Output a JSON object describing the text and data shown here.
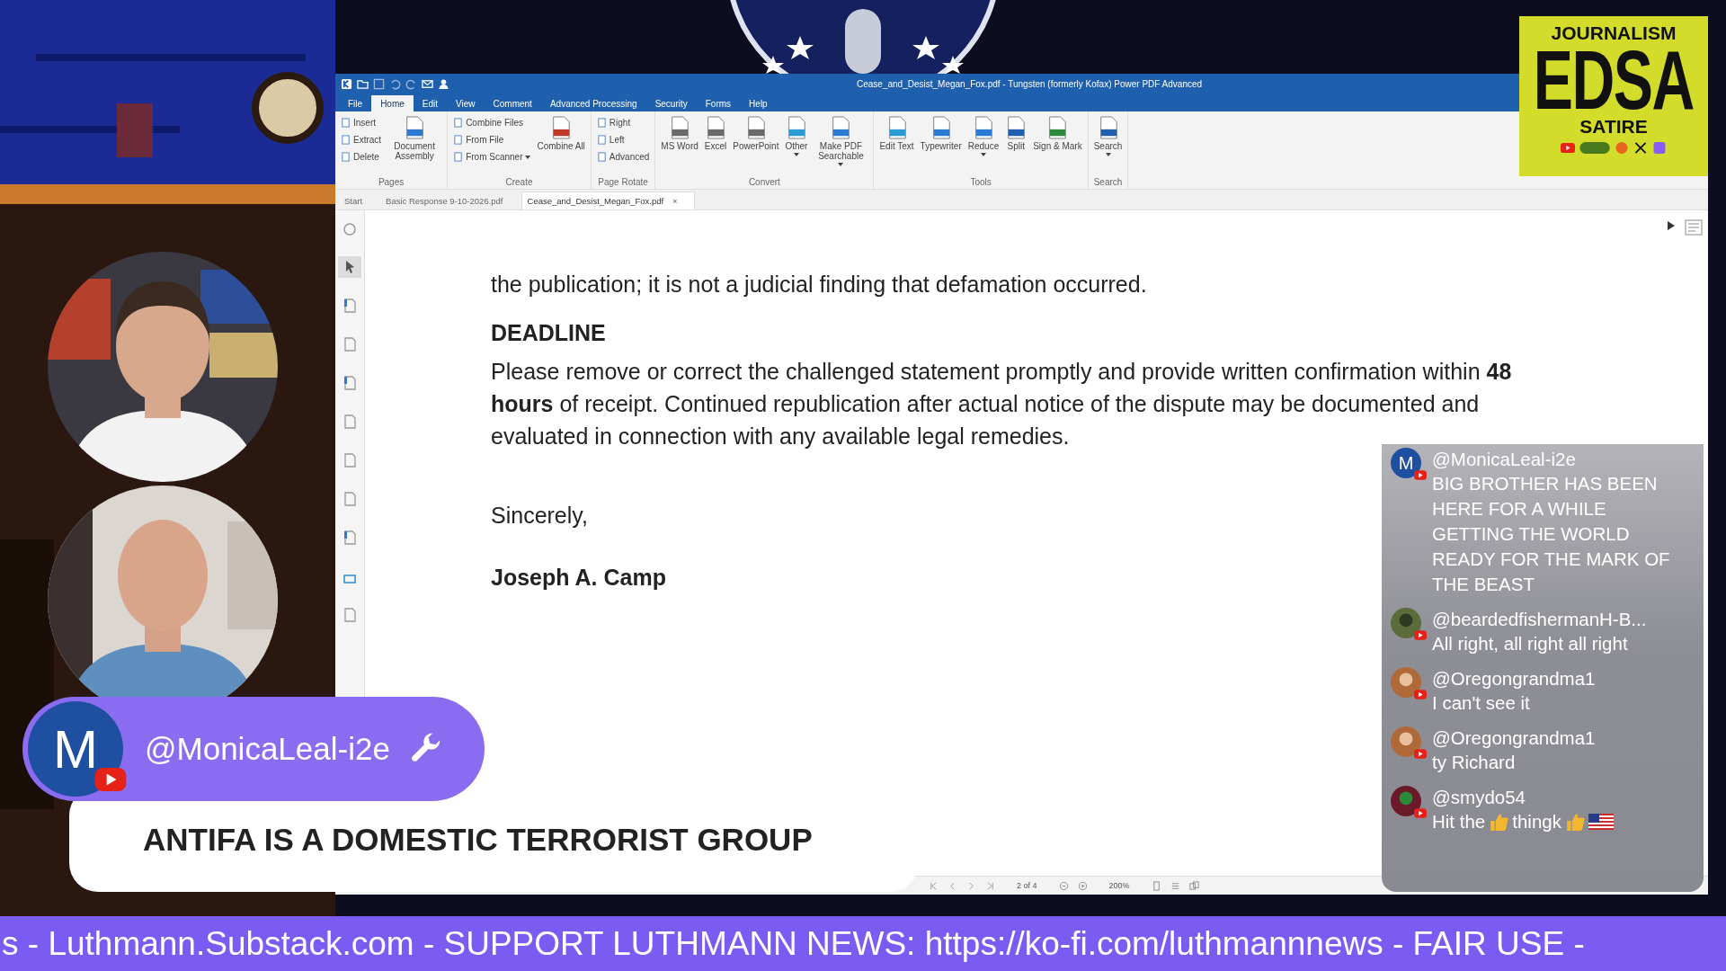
{
  "window": {
    "title": "Cease_and_Desist_Megan_Fox.pdf - Tungsten (formerly Kofax) Power PDF Advanced",
    "menu_tabs": [
      {
        "label": "File",
        "selected": false
      },
      {
        "label": "Home",
        "selected": true
      },
      {
        "label": "Edit",
        "selected": false
      },
      {
        "label": "View",
        "selected": false
      },
      {
        "label": "Comment",
        "selected": false
      },
      {
        "label": "Advanced Processing",
        "selected": false
      },
      {
        "label": "Security",
        "selected": false
      },
      {
        "label": "Forms",
        "selected": false
      },
      {
        "label": "Help",
        "selected": false
      }
    ],
    "ribbon": [
      {
        "label": "Pages",
        "buttons": [
          {
            "label": "Insert",
            "kind": "small",
            "dropdown": false
          },
          {
            "label": "Extract",
            "kind": "small",
            "dropdown": false
          },
          {
            "label": "Delete",
            "kind": "small",
            "dropdown": false
          },
          {
            "label": "Document Assembly",
            "kind": "large",
            "dropdown": false
          }
        ]
      },
      {
        "label": "Create",
        "buttons": [
          {
            "label": "Combine Files",
            "kind": "small",
            "dropdown": false
          },
          {
            "label": "From File",
            "kind": "small",
            "dropdown": false
          },
          {
            "label": "From Scanner",
            "kind": "small",
            "dropdown": true
          },
          {
            "label": "Combine All",
            "kind": "large",
            "dropdown": false
          }
        ]
      },
      {
        "label": "Page Rotate",
        "buttons": [
          {
            "label": "Right",
            "kind": "small",
            "dropdown": false
          },
          {
            "label": "Left",
            "kind": "small",
            "dropdown": false
          },
          {
            "label": "Advanced",
            "kind": "small",
            "dropdown": false
          }
        ]
      },
      {
        "label": "Convert",
        "buttons": [
          {
            "label": "MS Word",
            "kind": "large",
            "dropdown": false
          },
          {
            "label": "Excel",
            "kind": "large",
            "dropdown": false
          },
          {
            "label": "PowerPoint",
            "kind": "large",
            "dropdown": false
          },
          {
            "label": "Other",
            "kind": "large",
            "dropdown": true
          },
          {
            "label": "Make PDF Searchable",
            "kind": "large",
            "dropdown": true
          }
        ]
      },
      {
        "label": "Tools",
        "buttons": [
          {
            "label": "Edit Text",
            "kind": "large",
            "dropdown": false
          },
          {
            "label": "Typewriter",
            "kind": "large",
            "dropdown": false
          },
          {
            "label": "Reduce",
            "kind": "large",
            "dropdown": true
          },
          {
            "label": "Split",
            "kind": "large",
            "dropdown": false
          },
          {
            "label": "Sign & Mark",
            "kind": "large",
            "dropdown": false
          }
        ]
      },
      {
        "label": "Search",
        "buttons": [
          {
            "label": "Search",
            "kind": "large",
            "dropdown": true
          }
        ]
      }
    ],
    "doc_tabs": [
      {
        "label": "Start",
        "selected": false
      },
      {
        "label": "Basic Response 9-10-2026.pdf",
        "selected": false
      },
      {
        "label": "Cease_and_Desist_Megan_Fox.pdf",
        "selected": true,
        "close": "×"
      }
    ],
    "tools": [
      {
        "selected": false
      },
      {
        "selected": true
      },
      {
        "selected": false
      },
      {
        "selected": false
      },
      {
        "selected": false
      },
      {
        "selected": false
      },
      {
        "selected": false
      },
      {
        "selected": false
      },
      {
        "selected": false
      },
      {
        "selected": false
      },
      {
        "selected": false
      }
    ],
    "document": [
      {
        "kind": "text",
        "text": "the publication; it is not a judicial finding that defamation occurred."
      },
      {
        "kind": "heading",
        "text": "DEADLINE"
      },
      {
        "kind": "text",
        "text": "Please remove or correct the challenged statement promptly and provide written confirmation within **48 hours** of receipt. Continued republication after actual notice of the dispute may be documented and evaluated in connection with any available legal remedies."
      },
      {
        "kind": "closing",
        "text": "Sincerely,"
      },
      {
        "kind": "signature",
        "text": "Joseph A. Camp"
      }
    ],
    "status_bar": {
      "page": "2 of 4",
      "zoom": "200%"
    }
  },
  "logo": {
    "top": "JOURNALISM",
    "main": "EDSA",
    "sub": "SATIRE"
  },
  "chat": [
    {
      "author": "@MonicaLeal-i2e",
      "avatar_letter": "M",
      "parts": [
        {
          "kind": "text",
          "text": "BIG BROTHER HAS BEEN HERE FOR A WHILE GETTING THE WORLD READY FOR THE MARK OF THE BEAST"
        }
      ]
    },
    {
      "author": "@beardedfishermanH-B...",
      "parts": [
        {
          "kind": "text",
          "text": "All right, all right all right"
        }
      ]
    },
    {
      "author": "@Oregongrandma1",
      "parts": [
        {
          "kind": "text",
          "text": "I can't see it"
        }
      ]
    },
    {
      "author": "@Oregongrandma1",
      "parts": [
        {
          "kind": "text",
          "text": "ty Richard"
        }
      ]
    },
    {
      "author": "@smydo54",
      "parts": [
        {
          "kind": "text",
          "text": "Hit the"
        },
        {
          "kind": "thumbs_up"
        },
        {
          "kind": "text",
          "text": "thingk"
        },
        {
          "kind": "thumbs_up"
        },
        {
          "kind": "us_flag"
        }
      ]
    }
  ],
  "highlight": {
    "avatar_letter": "M",
    "author": "@MonicaLeal-i2e",
    "message": "ANTIFA IS A DOMESTIC TERRORIST GROUP"
  },
  "ticker": "s - Luthmann.Substack.com - SUPPORT LUTHMANN NEWS: https://ko-fi.com/luthmannnews - FAIR USE -"
}
